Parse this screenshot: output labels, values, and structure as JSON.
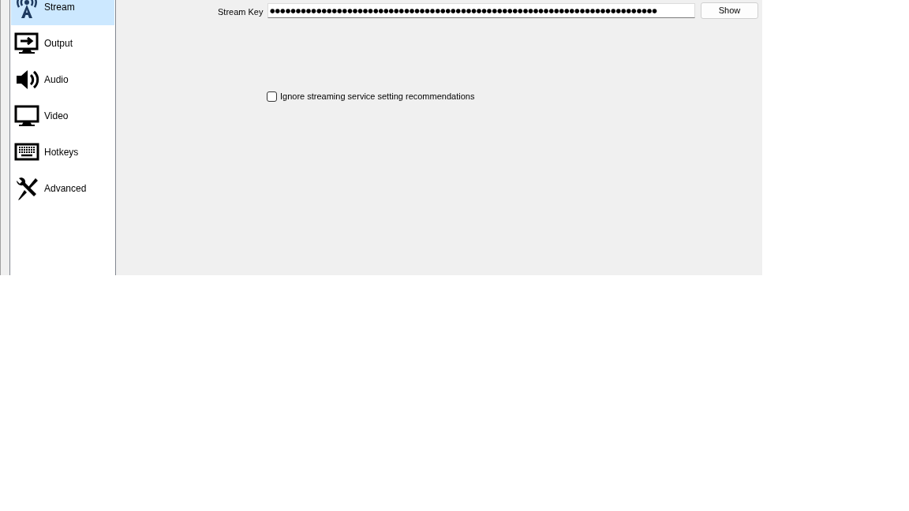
{
  "sidebar": {
    "items": [
      {
        "label": "Stream",
        "kind": "tower",
        "selected": true
      },
      {
        "label": "Output",
        "kind": "output",
        "selected": false
      },
      {
        "label": "Audio",
        "kind": "speaker",
        "selected": false
      },
      {
        "label": "Video",
        "kind": "monitor",
        "selected": false
      },
      {
        "label": "Hotkeys",
        "kind": "keyboard",
        "selected": false
      },
      {
        "label": "Advanced",
        "kind": "tools",
        "selected": false
      }
    ]
  },
  "stream_key": {
    "label": "Stream Key",
    "value": "●●●●●●●●●●●●●●●●●●●●●●●●●●●●●●●●●●●●●●●●●●●●●●●●●●●●●●●●●●●●●●●●●●●●●●●●●●●",
    "button": "Show"
  },
  "ignore_recommendations": {
    "label": "Ignore streaming service setting recommendations",
    "checked": false
  }
}
